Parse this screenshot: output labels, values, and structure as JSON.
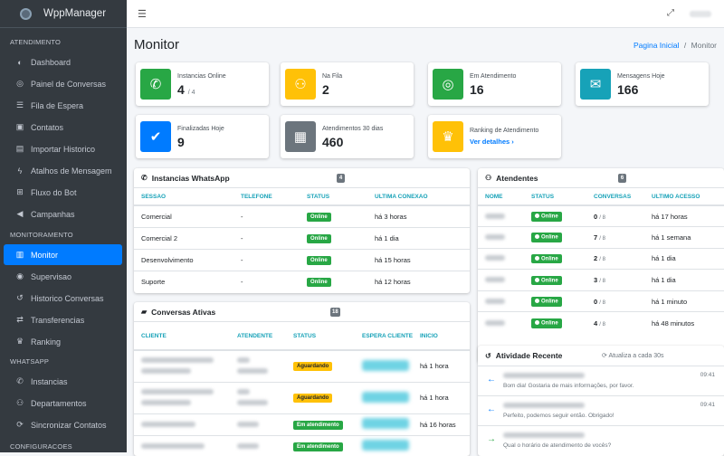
{
  "brand": {
    "name": "WppManager"
  },
  "sidebar": {
    "sections": [
      "ATENDIMENTO",
      "MONITORAMENTO",
      "WHATSAPP",
      "CONFIGURACOES"
    ],
    "items": [
      {
        "label": "Dashboard",
        "icon": "palette-icon"
      },
      {
        "label": "Painel de Conversas",
        "icon": "headset-icon"
      },
      {
        "label": "Fila de Espera",
        "icon": "list-icon"
      },
      {
        "label": "Contatos",
        "icon": "address-book-icon"
      },
      {
        "label": "Importar Historico",
        "icon": "file-import-icon"
      },
      {
        "label": "Atalhos de Mensagem",
        "icon": "bolt-icon"
      },
      {
        "label": "Fluxo do Bot",
        "icon": "sitemap-icon"
      },
      {
        "label": "Campanhas",
        "icon": "bullhorn-icon"
      },
      {
        "label": "Monitor",
        "icon": "chart-icon",
        "active": true
      },
      {
        "label": "Supervisao",
        "icon": "eye-icon"
      },
      {
        "label": "Historico Conversas",
        "icon": "history-icon"
      },
      {
        "label": "Transferencias",
        "icon": "exchange-icon"
      },
      {
        "label": "Ranking",
        "icon": "trophy-icon"
      },
      {
        "label": "Instancias",
        "icon": "whatsapp-icon"
      },
      {
        "label": "Departamentos",
        "icon": "users-icon"
      },
      {
        "label": "Sincronizar Contatos",
        "icon": "sync-icon"
      }
    ]
  },
  "page": {
    "title": "Monitor",
    "breadcrumb_home": "Pagina Inicial",
    "breadcrumb_sep": "/",
    "breadcrumb_current": "Monitor"
  },
  "stats": [
    {
      "label": "Instancias Online",
      "value": "4",
      "sub": "/ 4",
      "color": "#28a745",
      "icon": "whatsapp-icon"
    },
    {
      "label": "Na Fila",
      "value": "2",
      "sub": "",
      "color": "#ffc107",
      "icon": "users-icon"
    },
    {
      "label": "Em Atendimento",
      "value": "16",
      "sub": "",
      "color": "#28a745",
      "icon": "headset-icon"
    },
    {
      "label": "Mensagens Hoje",
      "value": "166",
      "sub": "",
      "color": "#17a2b8",
      "icon": "envelope-icon"
    },
    {
      "label": "Finalizadas Hoje",
      "value": "9",
      "sub": "",
      "color": "#007bff",
      "icon": "check-circle-icon"
    },
    {
      "label": "Atendimentos 30 dias",
      "value": "460",
      "sub": "",
      "color": "#6c757d",
      "icon": "calendar-icon"
    },
    {
      "label": "Ranking de Atendimento",
      "link": "Ver detalhes",
      "color": "#ffc107",
      "icon": "trophy-icon"
    }
  ],
  "instances": {
    "title": "Instancias WhatsApp",
    "count": "4",
    "headers": [
      "SESSAO",
      "TELEFONE",
      "STATUS",
      "ULTIMA CONEXAO"
    ],
    "rows": [
      {
        "session": "Comercial",
        "phone": "-",
        "status": "Online",
        "last": "há 3 horas"
      },
      {
        "session": "Comercial 2",
        "phone": "-",
        "status": "Online",
        "last": "há 1 dia"
      },
      {
        "session": "Desenvolvimento",
        "phone": "-",
        "status": "Online",
        "last": "há 15 horas"
      },
      {
        "session": "Suporte",
        "phone": "-",
        "status": "Online",
        "last": "há 12 horas"
      }
    ]
  },
  "agents": {
    "title": "Atendentes",
    "count": "6",
    "headers": [
      "NOME",
      "STATUS",
      "CONVERSAS",
      "ULTIMO ACESSO"
    ],
    "rows": [
      {
        "status": "Online",
        "conv": "0",
        "max": "/ 8",
        "last": "há 17 horas"
      },
      {
        "status": "Online",
        "conv": "7",
        "max": "/ 8",
        "last": "há 1 semana"
      },
      {
        "status": "Online",
        "conv": "2",
        "max": "/ 8",
        "last": "há 1 dia"
      },
      {
        "status": "Online",
        "conv": "3",
        "max": "/ 8",
        "last": "há 1 dia"
      },
      {
        "status": "Online",
        "conv": "0",
        "max": "/ 8",
        "last": "há 1 minuto"
      },
      {
        "status": "Online",
        "conv": "4",
        "max": "/ 8",
        "last": "há 48 minutos"
      }
    ]
  },
  "active_conversations": {
    "title": "Conversas Ativas",
    "count": "18",
    "headers": [
      "CLIENTE",
      "ATENDENTE",
      "STATUS",
      "ESPERA CLIENTE",
      "INICIO"
    ],
    "rows": [
      {
        "status": "Aguardando",
        "kind": "wait",
        "start": "há 1 hora"
      },
      {
        "status": "Aguardando",
        "kind": "wait",
        "start": "há 1 hora"
      },
      {
        "status": "Em atendimento",
        "kind": "att",
        "start": "há 16 horas"
      },
      {
        "status": "Em atendimento",
        "kind": "att",
        "start": ""
      }
    ]
  },
  "recent": {
    "title": "Atividade Recente",
    "refresh": "Atualiza a cada 30s",
    "items": [
      {
        "dir": "←",
        "color": "#007bff",
        "time": "09:41",
        "msg": "Bom dia! Gostaria de mais informações, por favor."
      },
      {
        "dir": "←",
        "color": "#007bff",
        "time": "09:41",
        "msg": "Perfeito, podemos seguir então. Obrigado!"
      },
      {
        "dir": "→",
        "color": "#28a745",
        "time": "",
        "msg": "Qual o horário de atendimento de vocês?"
      }
    ]
  }
}
